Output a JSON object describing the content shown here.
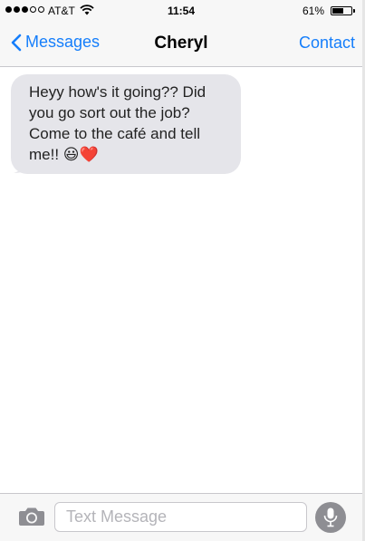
{
  "status_bar": {
    "carrier": "AT&T",
    "time": "11:54",
    "battery_percent": "61%",
    "battery_level": 0.61,
    "signal_bars_filled": 3,
    "signal_bars_total": 5
  },
  "nav": {
    "back_label": "Messages",
    "title": "Cheryl",
    "contact_label": "Contact"
  },
  "messages": [
    {
      "direction": "incoming",
      "text": "Heyy how's it going?? Did you go sort out the job? Come to the café and tell me!! 😃❤️"
    }
  ],
  "composer": {
    "placeholder": "Text Message",
    "value": ""
  },
  "icons": {
    "back": "chevron-left-icon",
    "wifi": "wifi-icon",
    "camera": "camera-icon",
    "microphone": "microphone-icon"
  },
  "colors": {
    "accent": "#157efb",
    "bubble_incoming": "#e5e5ea",
    "bar_background": "#f7f7f7",
    "mic_button": "#8e8e93"
  }
}
